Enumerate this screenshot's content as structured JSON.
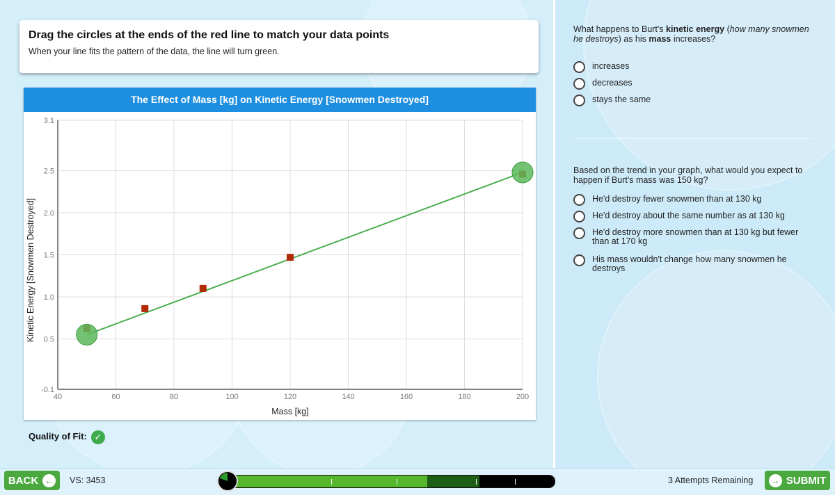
{
  "instructions": {
    "title": "Drag the circles at the ends of the red line to match your data points",
    "subtitle": "When your line fits the pattern of the data, the line will turn green."
  },
  "chart_data": {
    "type": "scatter",
    "title": "The Effect of Mass [kg] on Kinetic Energy [Snowmen Destroyed]",
    "xlabel": "Mass [kg]",
    "ylabel": "Kinetic Energy [Snowmen Destroyed]",
    "xlim": [
      40,
      200
    ],
    "ylim": [
      -0.1,
      3.1
    ],
    "x_ticks": [
      "40",
      "60",
      "80",
      "100",
      "120",
      "140",
      "160",
      "180",
      "200"
    ],
    "y_ticks": [
      "-0.1",
      "0.5",
      "1.0",
      "1.5",
      "2.0",
      "2.5",
      "3.1"
    ],
    "grid": true,
    "points": [
      {
        "x": 50,
        "y": 0.62
      },
      {
        "x": 70,
        "y": 0.86
      },
      {
        "x": 90,
        "y": 1.1
      },
      {
        "x": 120,
        "y": 1.47
      },
      {
        "x": 200,
        "y": 2.46
      }
    ],
    "fit_line": {
      "x1": 50,
      "y1": 0.55,
      "x2": 200,
      "y2": 2.48
    },
    "colors": {
      "points": "#b22a07",
      "line": "#4caf50",
      "handle": "#5cb85c",
      "header": "#1e8fe0"
    }
  },
  "quality": {
    "label": "Quality of Fit:",
    "icon": "check-icon"
  },
  "question1": {
    "text_before": "What happens to Burt's ",
    "bold1": "kinetic energy",
    "text_mid": " (",
    "italic": "how many snowmen he destroys",
    "text_mid2": ") as his ",
    "bold2": "mass",
    "text_after": " increases?",
    "options": [
      "increases",
      "decreases",
      "stays the same"
    ]
  },
  "question2": {
    "text": "Based on the trend in your graph, what would you expect to happen if Burt's mass was 150 kg?",
    "options": [
      "He'd destroy fewer snowmen than at 130 kg",
      "He'd destroy about the same number as at 130 kg",
      "He'd destroy more snowmen than at 130 kg but fewer than at 170 kg",
      "His mass wouldn't change how many snowmen he destroys"
    ]
  },
  "footer": {
    "back_label": "BACK",
    "vs": "VS: 3453",
    "attempts": "3 Attempts Remaining",
    "submit_label": "SUBMIT",
    "progress_complete": 0.61,
    "progress_current": 0.77
  }
}
